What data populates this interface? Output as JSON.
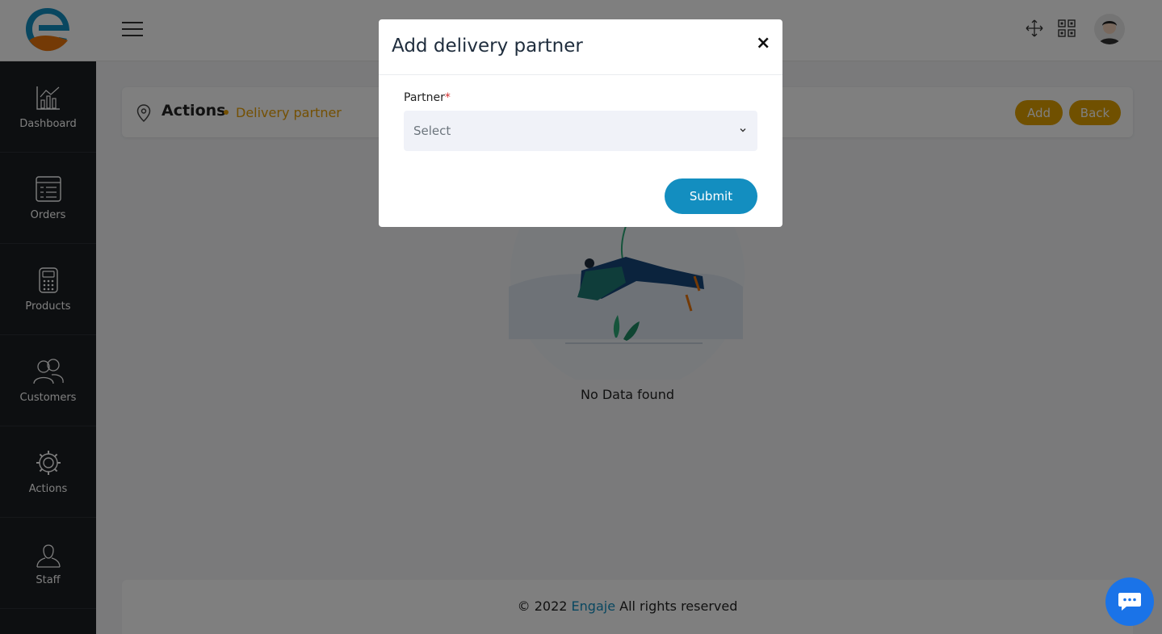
{
  "header": {
    "menu_icon": "hamburger-icon",
    "fullscreen_icon": "move-arrows-icon",
    "apps_icon": "grid-icon",
    "avatar_icon": "user-avatar"
  },
  "sidebar": {
    "items": [
      {
        "label": "Dashboard",
        "icon": "chart-icon"
      },
      {
        "label": "Orders",
        "icon": "list-icon"
      },
      {
        "label": "Products",
        "icon": "calculator-icon"
      },
      {
        "label": "Customers",
        "icon": "users-icon"
      },
      {
        "label": "Actions",
        "icon": "gear-icon"
      },
      {
        "label": "Staff",
        "icon": "user-icon"
      }
    ]
  },
  "breadcrumb": {
    "title": "Actions",
    "current": "Delivery partner",
    "add_label": "Add",
    "back_label": "Back"
  },
  "empty_state": {
    "message": "No Data found"
  },
  "footer": {
    "prefix": "© 2022",
    "brand": "Engaje",
    "suffix": "All rights reserved"
  },
  "modal": {
    "title": "Add delivery partner",
    "close_label": "×",
    "field_label": "Partner",
    "required_mark": "*",
    "select_value": "Select",
    "submit_label": "Submit"
  },
  "colors": {
    "accent": "#e8a007",
    "primary": "#138ec0",
    "sidebar": "#1b1e22",
    "chat": "#1a73e8"
  }
}
